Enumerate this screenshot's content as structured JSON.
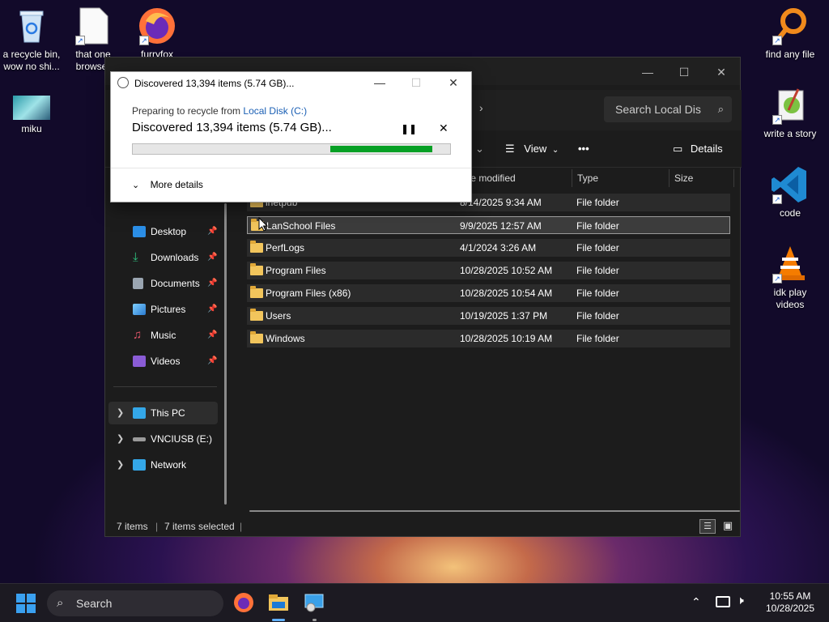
{
  "desktop": {
    "icons": [
      {
        "label": "a recycle bin, wow no shi..."
      },
      {
        "label": "that one browser"
      },
      {
        "label": "furryfox"
      },
      {
        "label": "miku"
      },
      {
        "label": "find any file"
      },
      {
        "label": "write a story"
      },
      {
        "label": "code"
      },
      {
        "label": "idk play videos"
      }
    ]
  },
  "explorer": {
    "search_placeholder": "Search Local Dis",
    "toolbar": {
      "view_label": "View",
      "more_label": "•••",
      "details_label": "Details"
    },
    "columns": {
      "date": "te modified",
      "type": "Type",
      "size": "Size"
    },
    "sidebar": [
      {
        "label": "Desktop",
        "icon": "desktop-icon",
        "color": "#2b8ee6"
      },
      {
        "label": "Downloads",
        "icon": "download-icon",
        "color": "#2ec27e"
      },
      {
        "label": "Documents",
        "icon": "documents-icon",
        "color": "#9aa5b1"
      },
      {
        "label": "Pictures",
        "icon": "pictures-icon",
        "color": "#3aa0e8"
      },
      {
        "label": "Music",
        "icon": "music-icon",
        "color": "#e3566a"
      },
      {
        "label": "Videos",
        "icon": "videos-icon",
        "color": "#8a5cd6"
      }
    ],
    "tree": [
      {
        "label": "This PC",
        "icon": "pc-icon"
      },
      {
        "label": "VNCIUSB (E:)",
        "icon": "drive-icon"
      },
      {
        "label": "Network",
        "icon": "network-icon"
      }
    ],
    "rows": [
      {
        "name": "inetpub",
        "date": "8/14/2025 9:34 AM",
        "type": "File folder"
      },
      {
        "name": "LanSchool Files",
        "date": "9/9/2025 12:57 AM",
        "type": "File folder"
      },
      {
        "name": "PerfLogs",
        "date": "4/1/2024 3:26 AM",
        "type": "File folder"
      },
      {
        "name": "Program Files",
        "date": "10/28/2025 10:52 AM",
        "type": "File folder"
      },
      {
        "name": "Program Files (x86)",
        "date": "10/28/2025 10:54 AM",
        "type": "File folder"
      },
      {
        "name": "Users",
        "date": "10/19/2025 1:37 PM",
        "type": "File folder"
      },
      {
        "name": "Windows",
        "date": "10/28/2025 10:19 AM",
        "type": "File folder"
      }
    ],
    "status": {
      "count": "7 items",
      "selected": "7 items selected"
    }
  },
  "dialog": {
    "title": "Discovered 13,394 items (5.74 GB)...",
    "prep_text": "Preparing to recycle from",
    "prep_link": "Local Disk (C:)",
    "main_text": "Discovered 13,394 items (5.74 GB)...",
    "progress_percent": 88,
    "more_details": "More details"
  },
  "taskbar": {
    "search_label": "Search",
    "time": "10:55 AM",
    "date": "10/28/2025"
  },
  "colors": {
    "accent": "#1a5fb4",
    "progress": "#06a025"
  }
}
